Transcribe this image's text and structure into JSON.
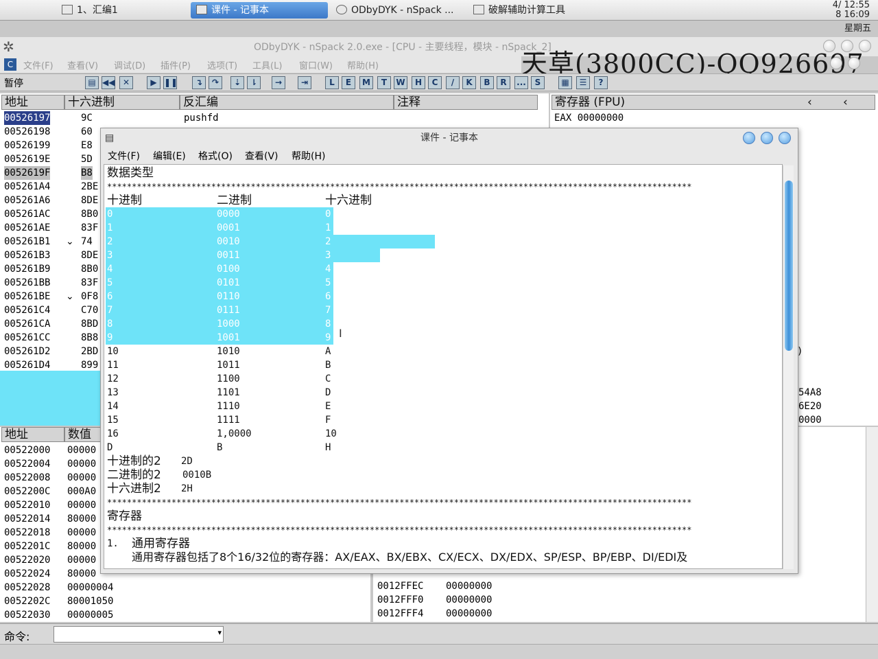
{
  "taskbar": {
    "tasks": [
      "1、汇编1",
      "课件 - 记事本",
      "ODbyDYK - nSpack ...",
      "破解辅助计算工具"
    ],
    "clock": "4/ 12:55",
    "date_small": "8   16:09",
    "weekday": "星期五"
  },
  "od": {
    "title": "ODbyDYK - nSpack 2.0.exe - [CPU - 主要线程，模块 - nSpack_2]",
    "watermark": "天草(3800CC)-QQ926697",
    "menu": [
      "文件(F)",
      "查看(V)",
      "调试(D)",
      "插件(P)",
      "选项(T)",
      "工具(L)",
      "窗口(W)",
      "帮助(H)"
    ],
    "status_pause": "暂停",
    "toolbar_letters": [
      "L",
      "E",
      "M",
      "T",
      "W",
      "H",
      "C",
      "/",
      "K",
      "B",
      "R",
      "...",
      "S"
    ],
    "cpu_headers": {
      "addr": "地址",
      "hex": "十六进制",
      "disasm": "反汇编",
      "comment": "注释"
    },
    "first_disasm": "pushfd",
    "cpu_rows": [
      {
        "addr": "00526197",
        "hex": "9C",
        "mark": ""
      },
      {
        "addr": "00526198",
        "hex": "60",
        "mark": ""
      },
      {
        "addr": "00526199",
        "hex": "E8",
        "mark": ""
      },
      {
        "addr": "0052619E",
        "hex": "5D",
        "mark": ""
      },
      {
        "addr": "0052619F",
        "hex": "B8",
        "mark": ""
      },
      {
        "addr": "005261A4",
        "hex": "2BE",
        "mark": ""
      },
      {
        "addr": "005261A6",
        "hex": "8DE",
        "mark": ""
      },
      {
        "addr": "005261AC",
        "hex": "8B0",
        "mark": ""
      },
      {
        "addr": "005261AE",
        "hex": "83F",
        "mark": ""
      },
      {
        "addr": "005261B1",
        "hex": "74",
        "mark": "⌄"
      },
      {
        "addr": "005261B3",
        "hex": "8DE",
        "mark": ""
      },
      {
        "addr": "005261B9",
        "hex": "8B0",
        "mark": ""
      },
      {
        "addr": "005261BB",
        "hex": "83F",
        "mark": ""
      },
      {
        "addr": "005261BE",
        "hex": "0F8",
        "mark": "⌄"
      },
      {
        "addr": "005261C4",
        "hex": "C70",
        "mark": ""
      },
      {
        "addr": "005261CA",
        "hex": "8BD",
        "mark": ""
      },
      {
        "addr": "005261CC",
        "hex": "8B8",
        "mark": ""
      },
      {
        "addr": "005261D2",
        "hex": "2BD",
        "mark": ""
      },
      {
        "addr": "005261D4",
        "hex": "899",
        "mark": ""
      }
    ],
    "reg_header": "寄存器 (FPU)",
    "reg_first": "EAX 00000000",
    "reg_right_vals": [
      ")",
      "54A8",
      "6E20",
      "0000"
    ],
    "dump_headers": {
      "addr": "地址",
      "val": "数值"
    },
    "dump_rows": [
      {
        "addr": "00522000",
        "val": "00000"
      },
      {
        "addr": "00522004",
        "val": "00000"
      },
      {
        "addr": "00522008",
        "val": "00000"
      },
      {
        "addr": "0052200C",
        "val": "000A0"
      },
      {
        "addr": "00522010",
        "val": "00000"
      },
      {
        "addr": "00522014",
        "val": "80000"
      },
      {
        "addr": "00522018",
        "val": "00000"
      },
      {
        "addr": "0052201C",
        "val": "80000"
      },
      {
        "addr": "00522020",
        "val": "00000"
      },
      {
        "addr": "00522024",
        "val": "80000"
      },
      {
        "addr": "00522028",
        "val": "00000004"
      },
      {
        "addr": "0052202C",
        "val": "80001050"
      },
      {
        "addr": "00522030",
        "val": "00000005"
      }
    ],
    "stack_rows": [
      {
        "addr": "0012FFEC",
        "val": "00000000"
      },
      {
        "addr": "0012FFF0",
        "val": "00000000"
      },
      {
        "addr": "0012FFF4",
        "val": "00000000"
      }
    ],
    "command_label": "命令:"
  },
  "notepad": {
    "title": "课件 - 记事本",
    "menu": [
      "文件(F)",
      "编辑(E)",
      "格式(O)",
      "查看(V)",
      "帮助(H)"
    ],
    "heading1": "数据类型",
    "stars": "**********************************************************************************************************************",
    "col_dec": "十进制",
    "col_bin": "二进制",
    "col_hex": "十六进制",
    "table": [
      [
        "0",
        "0000",
        "0"
      ],
      [
        "1",
        "0001",
        "1"
      ],
      [
        "2",
        "0010",
        "2"
      ],
      [
        "3",
        "0011",
        "3"
      ],
      [
        "4",
        "0100",
        "4"
      ],
      [
        "5",
        "0101",
        "5"
      ],
      [
        "6",
        "0110",
        "6"
      ],
      [
        "7",
        "0111",
        "7"
      ],
      [
        "8",
        "1000",
        "8"
      ],
      [
        "9",
        "1001",
        "9"
      ],
      [
        "10",
        "1010",
        "A"
      ],
      [
        "11",
        "1011",
        "B"
      ],
      [
        "12",
        "1100",
        "C"
      ],
      [
        "13",
        "1101",
        "D"
      ],
      [
        "14",
        "1110",
        "E"
      ],
      [
        "15",
        "1111",
        "F"
      ],
      [
        "16",
        "1,0000",
        "10"
      ],
      [
        "D",
        "B",
        "H"
      ]
    ],
    "dec2_label": "十进制的2",
    "dec2_val": "2D",
    "bin2_label": "二进制的2",
    "bin2_val": "0010B",
    "hex2_label": "十六进制2",
    "hex2_val": "2H",
    "heading2": "寄存器",
    "item1_num": "1.",
    "item1_title": "通用寄存器",
    "item1_text": "通用寄存器包括了8个16/32位的寄存器：AX/EAX、BX/EBX、CX/ECX、DX/EDX、SP/ESP、BP/EBP、DI/EDI及"
  },
  "colors": {
    "selection": "#6ee3f8",
    "active_task": "#3c78c8",
    "cpu_selected": "#6ee3f8"
  }
}
